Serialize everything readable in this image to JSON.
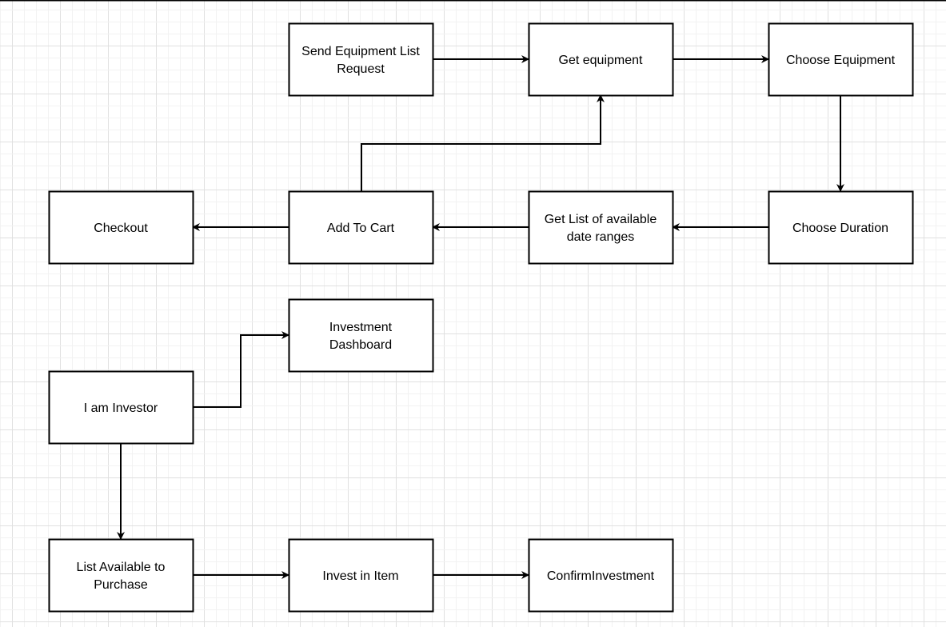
{
  "diagram": {
    "nodes": [
      {
        "id": "send-request",
        "lines": [
          "Send Equipment List",
          "Request"
        ]
      },
      {
        "id": "get-equipment",
        "lines": [
          "Get equipment"
        ]
      },
      {
        "id": "choose-equipment",
        "lines": [
          "Choose Equipment"
        ]
      },
      {
        "id": "checkout",
        "lines": [
          "Checkout"
        ]
      },
      {
        "id": "add-to-cart",
        "lines": [
          "Add To Cart"
        ]
      },
      {
        "id": "get-date-ranges",
        "lines": [
          "Get List of available",
          "date ranges"
        ]
      },
      {
        "id": "choose-duration",
        "lines": [
          "Choose Duration"
        ]
      },
      {
        "id": "investment-dashboard",
        "lines": [
          "Investment",
          "Dashboard"
        ]
      },
      {
        "id": "i-am-investor",
        "lines": [
          "I am Investor"
        ]
      },
      {
        "id": "list-available",
        "lines": [
          "List Available to",
          "Purchase"
        ]
      },
      {
        "id": "invest-in-item",
        "lines": [
          "Invest in Item"
        ]
      },
      {
        "id": "confirm-investment",
        "lines": [
          "ConfirmInvestment"
        ]
      }
    ],
    "edges": [
      {
        "from": "send-request",
        "to": "get-equipment"
      },
      {
        "from": "get-equipment",
        "to": "choose-equipment"
      },
      {
        "from": "choose-equipment",
        "to": "choose-duration"
      },
      {
        "from": "choose-duration",
        "to": "get-date-ranges"
      },
      {
        "from": "get-date-ranges",
        "to": "add-to-cart"
      },
      {
        "from": "add-to-cart",
        "to": "checkout"
      },
      {
        "from": "add-to-cart",
        "to": "get-equipment"
      },
      {
        "from": "i-am-investor",
        "to": "investment-dashboard"
      },
      {
        "from": "i-am-investor",
        "to": "list-available"
      },
      {
        "from": "list-available",
        "to": "invest-in-item"
      },
      {
        "from": "invest-in-item",
        "to": "confirm-investment"
      }
    ],
    "colors": {
      "stroke": "#000000",
      "grid_minor": "#f2f2f2",
      "grid_major": "#e0e0e0",
      "fill": "#ffffff"
    }
  }
}
